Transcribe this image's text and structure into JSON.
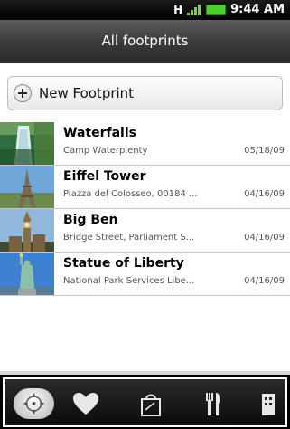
{
  "status_bar": {
    "time": "9:44 AM",
    "network_glyph": "H"
  },
  "title_bar": {
    "title": "All footprints"
  },
  "actions": {
    "new_footprint_label": "New Footprint"
  },
  "footprints": [
    {
      "title": "Waterfalls",
      "subtitle": "Camp Waterplenty",
      "date": "05/18/09",
      "thumb_icon": "waterfall-photo-icon"
    },
    {
      "title": "Eiffel Tower",
      "subtitle": "Piazza del Colosseo, 00184 ...",
      "date": "04/16/09",
      "thumb_icon": "eiffel-tower-photo-icon"
    },
    {
      "title": "Big Ben",
      "subtitle": "Bridge Street, Parliament S...",
      "date": "04/16/09",
      "thumb_icon": "big-ben-photo-icon"
    },
    {
      "title": "Statue of Liberty",
      "subtitle": "National Park Services Libe...",
      "date": "04/16/09",
      "thumb_icon": "statue-of-liberty-photo-icon"
    }
  ],
  "tabs": [
    {
      "name": "all",
      "icon": "compass-icon"
    },
    {
      "name": "favorites",
      "icon": "heart-icon"
    },
    {
      "name": "shopping",
      "icon": "shopping-bag-icon"
    },
    {
      "name": "restaurants",
      "icon": "fork-knife-icon"
    },
    {
      "name": "more",
      "icon": "building-icon"
    }
  ],
  "colors": {
    "status_bar": "#000000",
    "title_bar": "#3b3b3b",
    "battery": "#4fcf2e",
    "list_background": "#ffffff"
  }
}
